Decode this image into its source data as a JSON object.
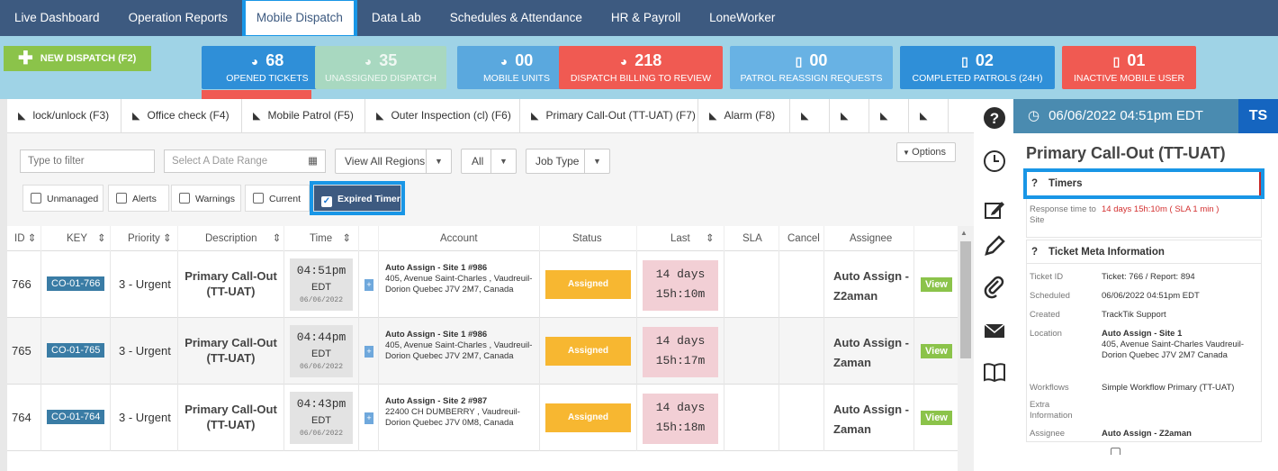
{
  "nav": {
    "items": [
      "Live Dashboard",
      "Operation Reports",
      "Mobile Dispatch",
      "Data Lab",
      "Schedules & Attendance",
      "HR & Payroll",
      "LoneWorker"
    ],
    "active": "Mobile Dispatch"
  },
  "new_dispatch": {
    "label": "NEW DISPATCH (F2)"
  },
  "stats": [
    {
      "value": "68",
      "label": "OPENED TICKETS",
      "icon": "pie-chart-icon",
      "color": "#2f8fd8"
    },
    {
      "value": "35",
      "label": "UNASSIGNED DISPATCH",
      "icon": "pie-chart-icon",
      "color": "#a8d8c0"
    },
    {
      "value": "00",
      "label": "MOBILE UNITS",
      "icon": "pie-chart-icon",
      "color": "#5aa8de"
    },
    {
      "value": "218",
      "label": "DISPATCH BILLING TO REVIEW",
      "icon": "pie-chart-icon",
      "color": "#f05a52"
    },
    {
      "value": "00",
      "label": "PATROL REASSIGN REQUESTS",
      "icon": "phone-icon",
      "color": "#68b2e4"
    },
    {
      "value": "02",
      "label": "COMPLETED PATROLS (24H)",
      "icon": "phone-icon",
      "color": "#2f8fd8"
    },
    {
      "value": "01",
      "label": "INACTIVE MOBILE USER",
      "icon": "phone-icon",
      "color": "#f05a52"
    }
  ],
  "tabs": [
    "lock/unlock (F3)",
    "Office check (F4)",
    "Mobile Patrol (F5)",
    "Outer Inspection (cl) (F6)",
    "Primary Call-Out (TT-UAT) (F7)",
    "Alarm (F8)",
    "",
    "",
    "",
    ""
  ],
  "filters": {
    "filter_placeholder": "Type to filter",
    "date_placeholder": "Select A Date Range",
    "regions": "View All Regions",
    "all": "All",
    "job_type": "Job Type",
    "options": "Options"
  },
  "checkboxes": [
    {
      "label": "Unmanaged",
      "checked": false
    },
    {
      "label": "Alerts",
      "checked": false
    },
    {
      "label": "Warnings",
      "checked": false
    },
    {
      "label": "Current",
      "checked": false
    },
    {
      "label": "Expired Timer",
      "checked": true
    }
  ],
  "table": {
    "headers": [
      "ID",
      "KEY",
      "Priority",
      "Description",
      "Time",
      "Account",
      "Status",
      "Last",
      "SLA",
      "Cancel",
      "Assignee"
    ],
    "rows": [
      {
        "id": "766",
        "key": "CO-01-766",
        "priority": "3 - Urgent",
        "description": "Primary Call-Out (TT-UAT)",
        "time": "04:51pm",
        "tz": "EDT",
        "date": "06/06/2022",
        "account_name": "Auto Assign - Site 1 #986",
        "account_addr": "405, Avenue Saint-Charles , Vaudreuil-Dorion Quebec J7V 2M7, Canada",
        "status": "Assigned",
        "last1": "14 days",
        "last2": "15h:10m",
        "assignee": "Auto Assign - Z2aman",
        "view": "View"
      },
      {
        "id": "765",
        "key": "CO-01-765",
        "priority": "3 - Urgent",
        "description": "Primary Call-Out (TT-UAT)",
        "time": "04:44pm",
        "tz": "EDT",
        "date": "06/06/2022",
        "account_name": "Auto Assign - Site 1 #986",
        "account_addr": "405, Avenue Saint-Charles , Vaudreuil-Dorion Quebec J7V 2M7, Canada",
        "status": "Assigned",
        "last1": "14 days",
        "last2": "15h:17m",
        "assignee": "Auto Assign - Zaman",
        "view": "View"
      },
      {
        "id": "764",
        "key": "CO-01-764",
        "priority": "3 - Urgent",
        "description": "Primary Call-Out (TT-UAT)",
        "time": "04:43pm",
        "tz": "EDT",
        "date": "06/06/2022",
        "account_name": "Auto Assign - Site 2 #987",
        "account_addr": "22400 CH DUMBERRY , Vaudreuil-Dorion Quebec J7V 0M8, Canada",
        "status": "Assigned",
        "last1": "14 days",
        "last2": "15h:18m",
        "assignee": "Auto Assign - Zaman",
        "view": "View"
      }
    ]
  },
  "panel": {
    "datetime": "06/06/2022 04:51pm EDT",
    "user": "TS",
    "title": "Primary Call-Out (TT-UAT)",
    "timers_title": "Timers",
    "response_label": "Response time to Site",
    "response_value": "14 days 15h:10m ( SLA 1 min )",
    "meta_title": "Ticket Meta Information",
    "meta": {
      "ticket_id_label": "Ticket ID",
      "ticket_id": "Ticket: 766 / Report: 894",
      "scheduled_label": "Scheduled",
      "scheduled": "06/06/2022 04:51pm EDT",
      "created_label": "Created",
      "created": "TrackTik Support",
      "location_label": "Location",
      "location_name": "Auto Assign - Site 1",
      "location_addr": "405, Avenue Saint-Charles Vaudreuil-Dorion Quebec J7V 2M7 Canada",
      "workflows_label": "Workflows",
      "workflows": "Simple Workflow Primary (TT-UAT)",
      "extra_label": "Extra Information",
      "assignee_label": "Assignee",
      "assignee": "Auto Assign - Z2aman"
    }
  }
}
